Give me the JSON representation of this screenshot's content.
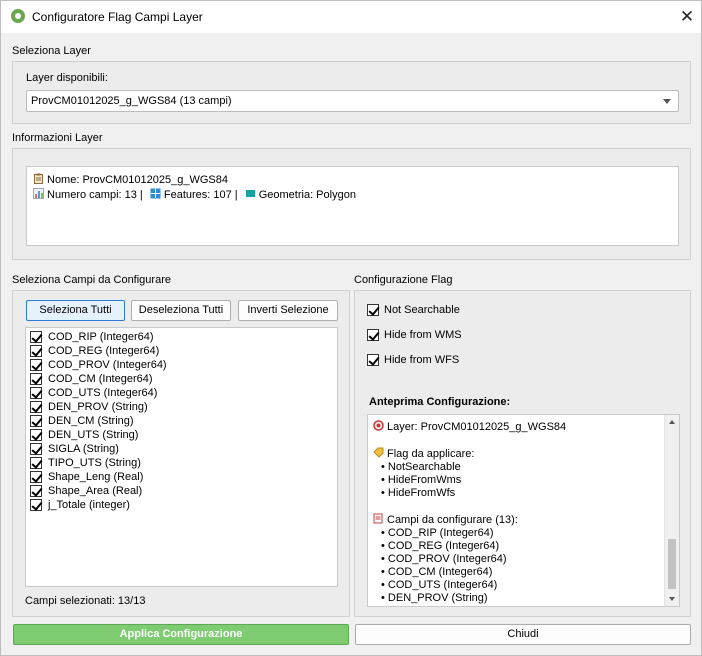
{
  "window": {
    "title": "Configuratore Flag Campi Layer",
    "close_glyph": "✕"
  },
  "layer_select": {
    "section_title": "Seleziona Layer",
    "label": "Layer disponibili:",
    "selected": "ProvCM01012025_g_WGS84 (13 campi)"
  },
  "layer_info": {
    "section_title": "Informazioni Layer",
    "name_line": "Nome: ProvCM01012025_g_WGS84",
    "fields_count": "Numero campi: 13 |",
    "features": "Features: 107 |",
    "geometry": "Geometria: Polygon"
  },
  "fields_panel": {
    "section_title": "Seleziona Campi da Configurare",
    "select_all": "Seleziona Tutti",
    "deselect_all": "Deseleziona Tutti",
    "invert": "Inverti Selezione",
    "fields": [
      {
        "label": "COD_RIP (Integer64)",
        "checked": true
      },
      {
        "label": "COD_REG (Integer64)",
        "checked": true
      },
      {
        "label": "COD_PROV (Integer64)",
        "checked": true
      },
      {
        "label": "COD_CM (Integer64)",
        "checked": true
      },
      {
        "label": "COD_UTS (Integer64)",
        "checked": true
      },
      {
        "label": "DEN_PROV (String)",
        "checked": true
      },
      {
        "label": "DEN_CM (String)",
        "checked": true
      },
      {
        "label": "DEN_UTS (String)",
        "checked": true
      },
      {
        "label": "SIGLA (String)",
        "checked": true
      },
      {
        "label": "TIPO_UTS (String)",
        "checked": true
      },
      {
        "label": "Shape_Leng (Real)",
        "checked": true
      },
      {
        "label": "Shape_Area (Real)",
        "checked": true
      },
      {
        "label": "j_Totale (integer)",
        "checked": true
      }
    ],
    "selected_count": "Campi selezionati: 13/13"
  },
  "flags_panel": {
    "section_title": "Configurazione Flag",
    "not_searchable": "Not Searchable",
    "hide_wms": "Hide from WMS",
    "hide_wfs": "Hide from WFS",
    "preview_title": "Anteprima Configurazione:",
    "preview": {
      "layer_line": "Layer: ProvCM01012025_g_WGS84",
      "flags_heading": "Flag da applicare:",
      "flags": [
        "NotSearchable",
        "HideFromWms",
        "HideFromWfs"
      ],
      "fields_heading": "Campi da configurare (13):",
      "fields": [
        "COD_RIP (Integer64)",
        "COD_REG (Integer64)",
        "COD_PROV (Integer64)",
        "COD_CM (Integer64)",
        "COD_UTS (Integer64)",
        "DEN_PROV (String)"
      ]
    }
  },
  "footer": {
    "apply": "Applica Configurazione",
    "close": "Chiudi"
  },
  "colors": {
    "apply_button": "#7ecb72",
    "selected_button_border": "#2d7bd5"
  },
  "icons": [
    "qgis-logo-icon",
    "clipboard-icon",
    "bar-chart-icon",
    "grid-icon",
    "polygon-icon",
    "target-icon",
    "tag-icon",
    "memo-icon",
    "checkbox-icon"
  ]
}
